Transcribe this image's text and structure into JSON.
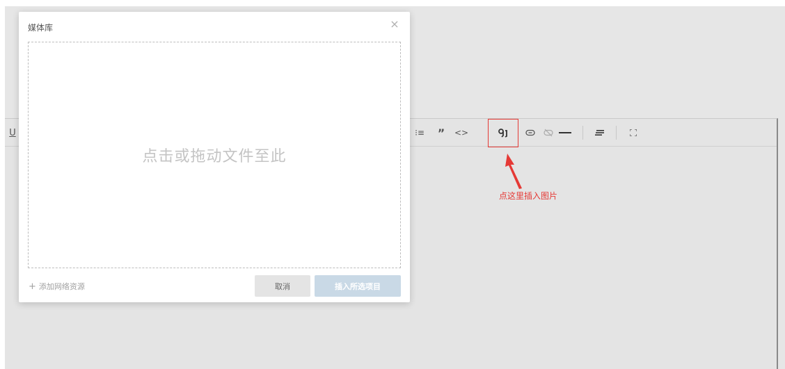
{
  "toolbar": {
    "underline_label": "U",
    "ordered_list_label": "⁝≡",
    "quote_label": "”",
    "code_label": "<>",
    "image_label": "🖻",
    "link_label": "⊖",
    "unlink_label": "⊘",
    "hr_label": "—",
    "align_label": "≡",
    "fullscreen_label": "⛶"
  },
  "annotation": {
    "text": "点这里插入图片",
    "color": "#e53935"
  },
  "modal": {
    "title": "媒体库",
    "close_label": "×",
    "dropzone_text": "点击或拖动文件至此",
    "add_network_label": "添加网络资源",
    "add_network_plus": "+",
    "cancel_label": "取消",
    "insert_label": "插入所选项目"
  },
  "colors": {
    "insert_button_disabled": "#c9d9e6",
    "cancel_button": "#e4e4e4",
    "overlay": "#e6e6e6"
  }
}
